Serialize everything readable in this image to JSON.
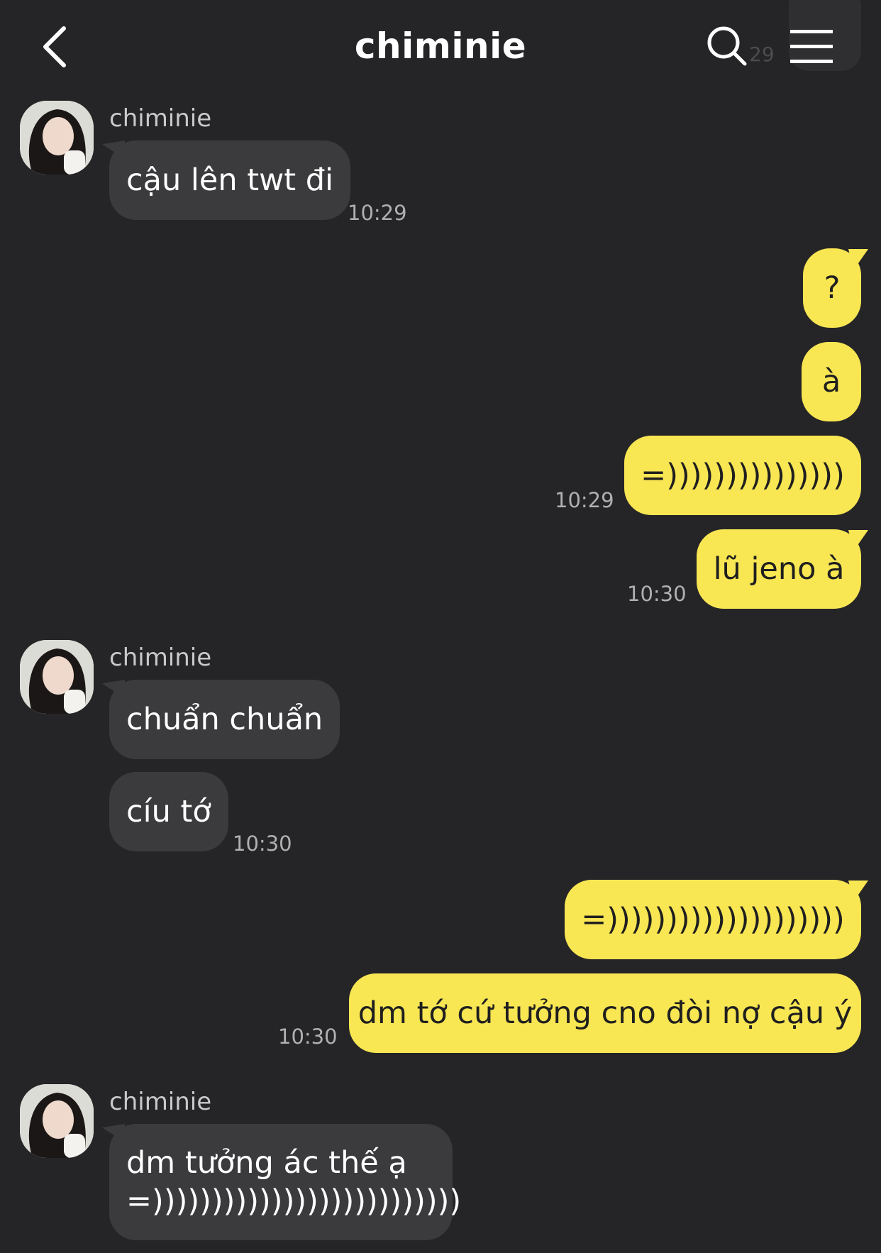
{
  "header": {
    "title": "chiminie",
    "back_icon": "chevron-left-icon",
    "search_icon": "search-icon",
    "menu_icon": "hamburger-menu-icon",
    "ghost_time": "29"
  },
  "colors": {
    "background": "#252527",
    "incoming": "#3b3b3d",
    "outgoing": "#f8e653"
  },
  "messages": {
    "g1": {
      "sender": "chiminie",
      "b1": "cậu lên twt đi",
      "time": "10:29"
    },
    "g2": {
      "b1": "?",
      "b2": "à",
      "b3": "=)))))))))))))))",
      "time1": "10:29",
      "b4": "lũ jeno à",
      "time2": "10:30"
    },
    "g3": {
      "sender": "chiminie",
      "b1": "chuẩn chuẩn",
      "b2": "cíu tớ",
      "time": "10:30"
    },
    "g4": {
      "b1": "=))))))))))))))))))))",
      "b2": "dm tớ cứ tưởng cno đòi nợ cậu ý",
      "time": "10:30"
    },
    "g5": {
      "sender": "chiminie",
      "line1": "dm tưởng ác thế ạ",
      "line2": "=))))))))))))))))))))))))))"
    }
  }
}
